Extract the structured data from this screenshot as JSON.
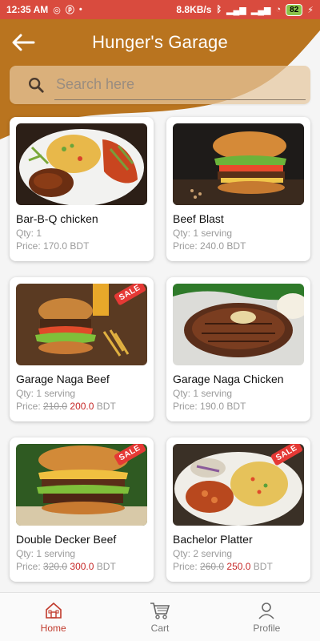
{
  "status_bar": {
    "time": "12:35 AM",
    "speed": "8.8KB/s",
    "battery": "82"
  },
  "header": {
    "title": "Hunger's Garage",
    "back_icon": "arrow-left-icon"
  },
  "search": {
    "placeholder": "Search here",
    "value": ""
  },
  "products": [
    {
      "name": "Bar-B-Q chicken",
      "qty_label": "Qty:",
      "qty": "1",
      "price_label": "Price:",
      "old_price": "",
      "price": "170.0",
      "currency": "BDT",
      "sale": false
    },
    {
      "name": "Beef Blast",
      "qty_label": "Qty:",
      "qty": "1 serving",
      "price_label": "Price:",
      "old_price": "",
      "price": "240.0",
      "currency": "BDT",
      "sale": false
    },
    {
      "name": "Garage Naga Beef",
      "qty_label": "Qty:",
      "qty": "1 serving",
      "price_label": "Price:",
      "old_price": "210.0",
      "price": "200.0",
      "currency": "BDT",
      "sale": true
    },
    {
      "name": "Garage Naga Chicken",
      "qty_label": "Qty:",
      "qty": "1 serving",
      "price_label": "Price:",
      "old_price": "",
      "price": "190.0",
      "currency": "BDT",
      "sale": false
    },
    {
      "name": "Double Decker Beef",
      "qty_label": "Qty:",
      "qty": "1 serving",
      "price_label": "Price:",
      "old_price": "320.0",
      "price": "300.0",
      "currency": "BDT",
      "sale": true
    },
    {
      "name": "Bachelor Platter",
      "qty_label": "Qty:",
      "qty": "2 serving",
      "price_label": "Price:",
      "old_price": "260.0",
      "price": "250.0",
      "currency": "BDT",
      "sale": true
    }
  ],
  "sale_label": "SALE",
  "bottom_nav": {
    "items": [
      {
        "label": "Home",
        "icon": "home-icon",
        "active": true
      },
      {
        "label": "Cart",
        "icon": "cart-icon",
        "active": false
      },
      {
        "label": "Profile",
        "icon": "profile-icon",
        "active": false
      }
    ]
  },
  "colors": {
    "status_bar": "#d94b3e",
    "header": "#b9741f",
    "accent": "#c0392b",
    "sale_price": "#c62828"
  }
}
